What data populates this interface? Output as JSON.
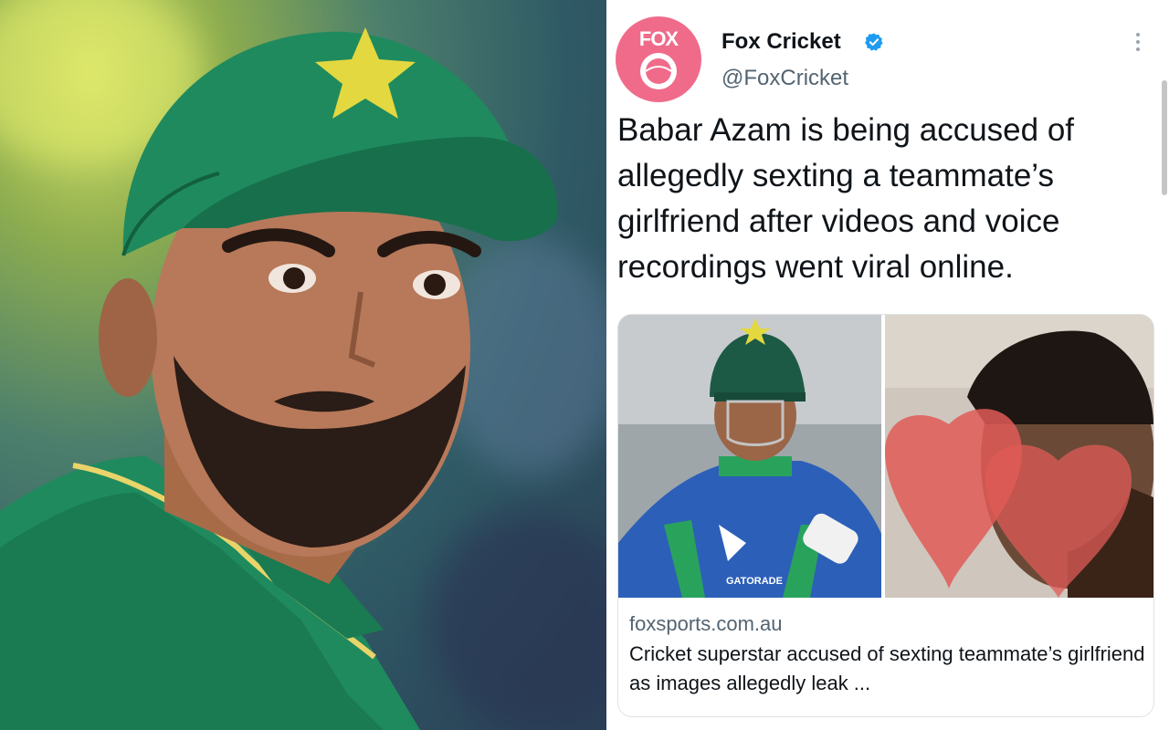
{
  "tweet": {
    "account_name": "Fox Cricket",
    "handle": "@FoxCricket",
    "avatar_logo_text": "FOX",
    "text": "Babar Azam is being accused of allegedly sexting a teammate’s girlfriend after videos and voice recordings went viral online.",
    "card": {
      "domain": "foxsports.com.au",
      "title": "Cricket superstar accused of sexting teammate’s girlfriend as images allegedly leak ...",
      "jersey_sponsor": "GATORADE"
    }
  },
  "colors": {
    "avatar_pink": "#f06b8a",
    "verified_blue": "#1d9bf0",
    "pakistan_green": "#1f8a5e"
  },
  "icons": [
    "verified-badge-icon",
    "more-options-icon",
    "fox-cricket-logo"
  ]
}
